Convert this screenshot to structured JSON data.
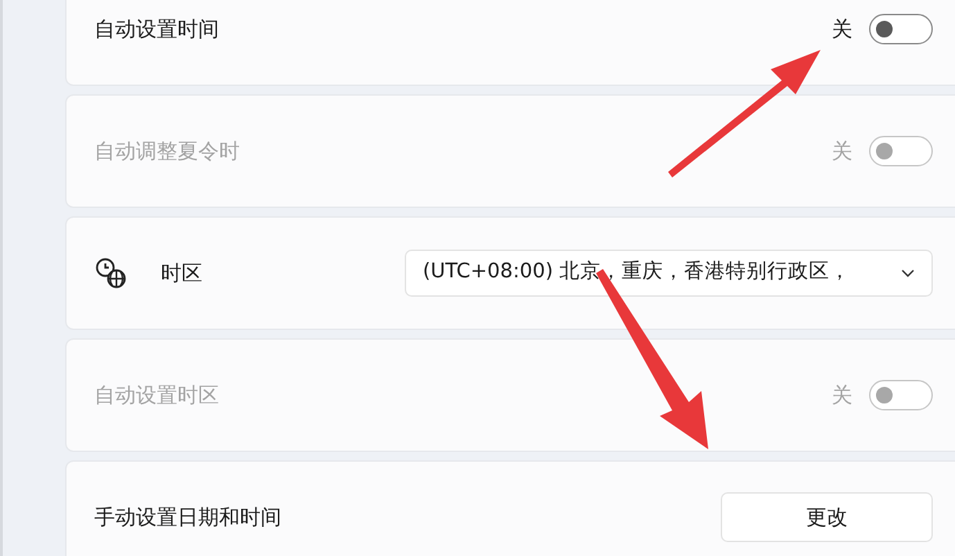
{
  "rows": [
    {
      "kind": "toggle",
      "label": "自动设置时间",
      "state_label": "关",
      "on": false,
      "disabled": false
    },
    {
      "kind": "toggle",
      "label": "自动调整夏令时",
      "state_label": "关",
      "on": false,
      "disabled": true
    },
    {
      "kind": "dropdown",
      "label": "时区",
      "value": "(UTC+08:00) 北京，重庆，香港特别行政区，"
    },
    {
      "kind": "toggle",
      "label": "自动设置时区",
      "state_label": "关",
      "on": false,
      "disabled": true
    },
    {
      "kind": "button",
      "label": "手动设置日期和时间",
      "button": "更改"
    }
  ]
}
